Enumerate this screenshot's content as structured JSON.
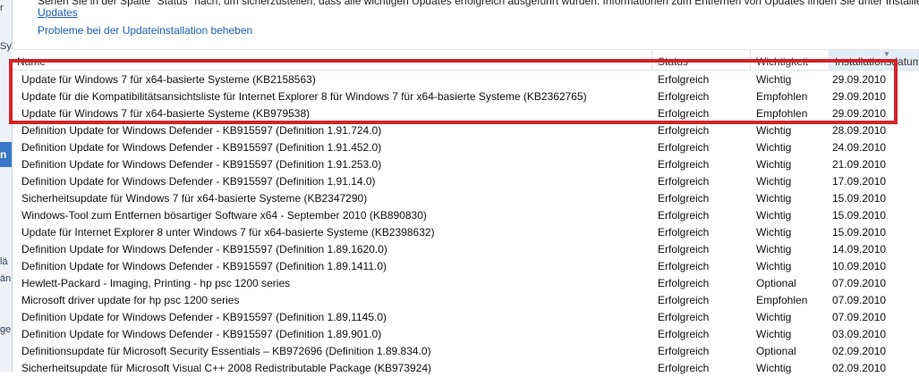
{
  "intro": {
    "text": "Sehen Sie in der Spalte \"Status\" nach, um sicherzustellen, dass alle wichtigen Updates erfolgreich ausgeführt wurden. Informationen zum Entfernen von Updates finden Sie unter Installierte",
    "link_text": "Updates",
    "help_link": "Probleme bei der Updateinstallation beheben"
  },
  "left_strip": [
    "r",
    "Sy",
    "n",
    "lä",
    "än",
    "ge"
  ],
  "columns": {
    "name": "Name",
    "status": "Status",
    "importance": "Wichtigkeit",
    "date": "Installationsdatum"
  },
  "rows": [
    {
      "name": "Update für Windows 7 für x64-basierte Systeme (KB2158563)",
      "status": "Erfolgreich",
      "importance": "Wichtig",
      "date": "29.09.2010"
    },
    {
      "name": "Update für die Kompatibilitätsansichtsliste für Internet Explorer 8 für Windows 7 für x64-basierte Systeme (KB2362765)",
      "status": "Erfolgreich",
      "importance": "Empfohlen",
      "date": "29.09.2010"
    },
    {
      "name": "Update für Windows 7 für x64-basierte Systeme (KB979538)",
      "status": "Erfolgreich",
      "importance": "Empfohlen",
      "date": "29.09.2010"
    },
    {
      "name": "Definition Update for Windows Defender - KB915597 (Definition 1.91.724.0)",
      "status": "Erfolgreich",
      "importance": "Wichtig",
      "date": "28.09.2010"
    },
    {
      "name": "Definition Update for Windows Defender - KB915597 (Definition 1.91.452.0)",
      "status": "Erfolgreich",
      "importance": "Wichtig",
      "date": "24.09.2010"
    },
    {
      "name": "Definition Update for Windows Defender - KB915597 (Definition 1.91.253.0)",
      "status": "Erfolgreich",
      "importance": "Wichtig",
      "date": "21.09.2010"
    },
    {
      "name": "Definition Update for Windows Defender - KB915597 (Definition 1.91.14.0)",
      "status": "Erfolgreich",
      "importance": "Wichtig",
      "date": "17.09.2010"
    },
    {
      "name": "Sicherheitsupdate für Windows 7 für x64-basierte Systeme (KB2347290)",
      "status": "Erfolgreich",
      "importance": "Wichtig",
      "date": "15.09.2010"
    },
    {
      "name": "Windows-Tool zum Entfernen bösartiger Software x64 - September 2010 (KB890830)",
      "status": "Erfolgreich",
      "importance": "Wichtig",
      "date": "15.09.2010"
    },
    {
      "name": "Update für Internet Explorer 8 unter Windows 7 für x64-basierte Systeme (KB2398632)",
      "status": "Erfolgreich",
      "importance": "Wichtig",
      "date": "15.09.2010"
    },
    {
      "name": "Definition Update for Windows Defender - KB915597 (Definition 1.89.1620.0)",
      "status": "Erfolgreich",
      "importance": "Wichtig",
      "date": "14.09.2010"
    },
    {
      "name": "Definition Update for Windows Defender - KB915597 (Definition 1.89.1411.0)",
      "status": "Erfolgreich",
      "importance": "Wichtig",
      "date": "10.09.2010"
    },
    {
      "name": "Hewlett-Packard  - Imaging, Printing - hp psc 1200 series",
      "status": "Erfolgreich",
      "importance": "Optional",
      "date": "07.09.2010"
    },
    {
      "name": "Microsoft driver update for hp psc 1200 series",
      "status": "Erfolgreich",
      "importance": "Empfohlen",
      "date": "07.09.2010"
    },
    {
      "name": "Definition Update for Windows Defender - KB915597 (Definition 1.89.1145.0)",
      "status": "Erfolgreich",
      "importance": "Wichtig",
      "date": "07.09.2010"
    },
    {
      "name": "Definition Update for Windows Defender - KB915597 (Definition 1.89.901.0)",
      "status": "Erfolgreich",
      "importance": "Wichtig",
      "date": "03.09.2010"
    },
    {
      "name": "Definitionsupdate für Microsoft Security Essentials – KB972696 (Definition 1.89.834.0)",
      "status": "Erfolgreich",
      "importance": "Optional",
      "date": "02.09.2010"
    },
    {
      "name": "Sicherheitsupdate für Microsoft Visual C++ 2008 Redistributable Package (KB973924)",
      "status": "Erfolgreich",
      "importance": "Wichtig",
      "date": "02.09.2010"
    }
  ]
}
